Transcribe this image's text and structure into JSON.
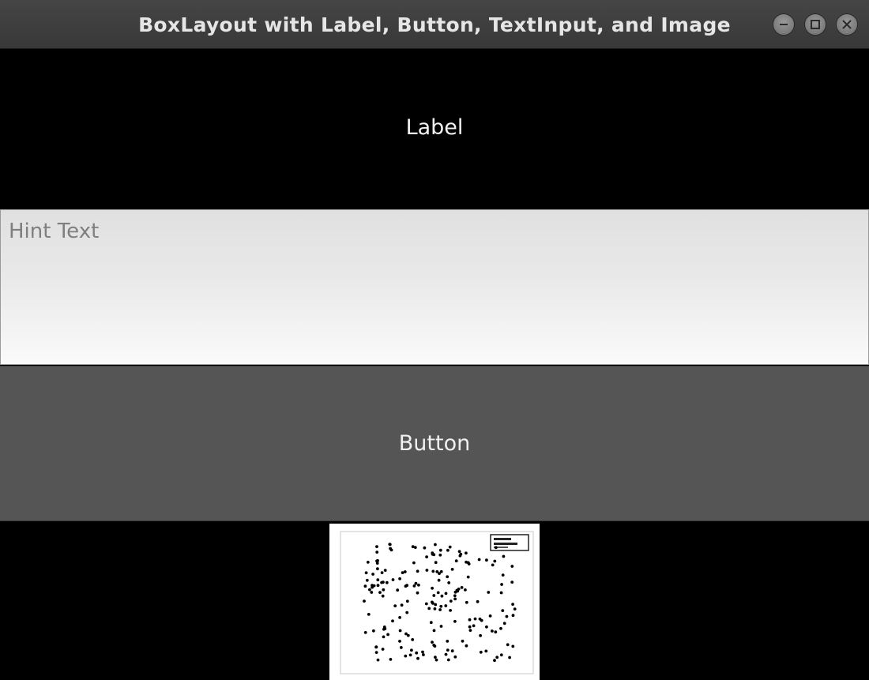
{
  "window": {
    "title": "BoxLayout with Label, Button, TextInput, and Image",
    "controls": [
      {
        "name": "minimize",
        "icon": "minimize-icon"
      },
      {
        "name": "maximize",
        "icon": "maximize-icon"
      },
      {
        "name": "close",
        "icon": "close-icon"
      }
    ]
  },
  "label": {
    "text": "Label"
  },
  "text_input": {
    "value": "",
    "placeholder": "Hint Text"
  },
  "button": {
    "label": "Button"
  },
  "image": {
    "content": "scatter-plot-thumbnail",
    "marker_color": "#000000"
  },
  "colors": {
    "background": "#000000",
    "titlebar": "#3c3c3c",
    "button": "#555555",
    "input_top": "#e0e0e0",
    "input_bottom": "#fafafa"
  }
}
